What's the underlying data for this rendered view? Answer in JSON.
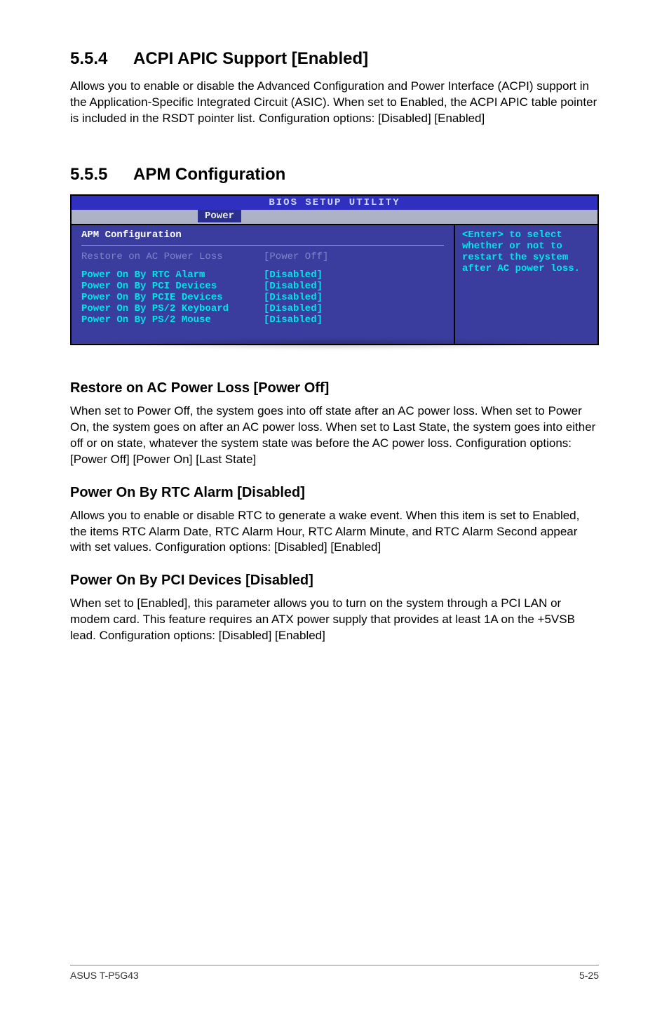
{
  "section554": {
    "num": "5.5.4",
    "title": "ACPI APIC Support [Enabled]",
    "body": "Allows you to enable or disable the Advanced Configuration and Power Interface (ACPI) support in the Application-Specific Integrated Circuit (ASIC). When set to Enabled, the ACPI APIC table pointer is included in the RSDT pointer list. Configuration options: [Disabled] [Enabled]"
  },
  "section555": {
    "num": "5.5.5",
    "title": "APM Configuration"
  },
  "bios": {
    "headerTitle": "BIOS SETUP UTILITY",
    "tab": "Power",
    "panelTitle": "APM Configuration",
    "highlighted": {
      "label": "Restore on AC Power Loss",
      "value": "[Power Off]"
    },
    "items": [
      {
        "label": "Power On By RTC Alarm",
        "value": "[Disabled]"
      },
      {
        "label": "Power On By PCI Devices",
        "value": "[Disabled]"
      },
      {
        "label": "Power On By PCIE Devices",
        "value": "[Disabled]"
      },
      {
        "label": "Power On By PS/2 Keyboard",
        "value": "[Disabled]"
      },
      {
        "label": "Power On By PS/2 Mouse",
        "value": "[Disabled]"
      }
    ],
    "help": "<Enter> to select whether or not to restart the system after AC power loss."
  },
  "restore": {
    "title": "Restore on AC Power Loss [Power Off]",
    "body": "When set to Power Off, the system goes into off state after an AC power loss. When set to Power On, the system goes on after an AC power loss. When set to Last State, the system goes into either off or on state, whatever the system state was before the AC power loss. Configuration options: [Power Off] [Power On] [Last State]"
  },
  "rtc": {
    "title": "Power On By RTC Alarm [Disabled]",
    "body": "Allows you to enable or disable RTC to generate a wake event. When this item is set to Enabled, the items RTC Alarm Date, RTC Alarm Hour, RTC Alarm Minute, and RTC Alarm Second appear with set values. Configuration options: [Disabled] [Enabled]"
  },
  "pci": {
    "title": "Power On By PCI Devices [Disabled]",
    "body": "When set to [Enabled], this parameter allows you to turn on the system through a PCI LAN or modem card. This feature requires an ATX power supply that provides at least 1A on the +5VSB lead. Configuration options: [Disabled] [Enabled]"
  },
  "footer": {
    "left": "ASUS T-P5G43",
    "right": "5-25"
  }
}
